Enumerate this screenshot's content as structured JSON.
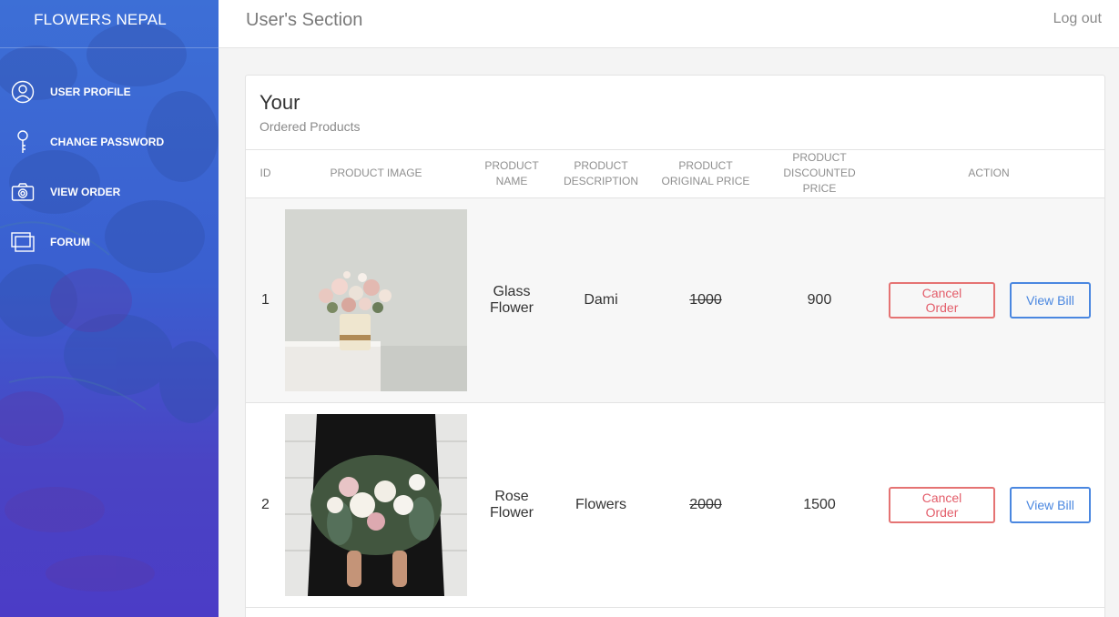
{
  "brand": "FLOWERS NEPAL",
  "sidebar": {
    "items": [
      {
        "label": "USER PROFILE",
        "icon": "user-circle-icon"
      },
      {
        "label": "CHANGE PASSWORD",
        "icon": "key-icon"
      },
      {
        "label": "VIEW ORDER",
        "icon": "camera-icon"
      },
      {
        "label": "FORUM",
        "icon": "windows-icon"
      }
    ]
  },
  "header": {
    "title": "User's Section",
    "logout": "Log out"
  },
  "card": {
    "title": "Your",
    "subtitle": "Ordered Products"
  },
  "table": {
    "headers": {
      "id": "ID",
      "image": "PRODUCT IMAGE",
      "name_1": "PRODUCT",
      "name_2": "NAME",
      "desc_1": "PRODUCT",
      "desc_2": "DESCRIPTION",
      "orig_1": "PRODUCT",
      "orig_2": "ORIGINAL PRICE",
      "disc_1": "PRODUCT",
      "disc_2": "DISCOUNTED PRICE",
      "action": "ACTION"
    },
    "rows": [
      {
        "id": "1",
        "name_1": "Glass",
        "name_2": "Flower",
        "description": "Dami",
        "original_price": "1000",
        "discounted_price": "900",
        "cancel_label": "Cancel Order",
        "bill_label": "View Bill"
      },
      {
        "id": "2",
        "name_1": "Rose",
        "name_2": "Flower",
        "description": "Flowers",
        "original_price": "2000",
        "discounted_price": "1500",
        "cancel_label": "Cancel Order",
        "bill_label": "View Bill"
      }
    ]
  },
  "colors": {
    "sidebar_top": "#3d6fd6",
    "sidebar_bottom": "#4b3cc6",
    "cancel": "#e35d6a",
    "bill": "#4a87e0"
  }
}
